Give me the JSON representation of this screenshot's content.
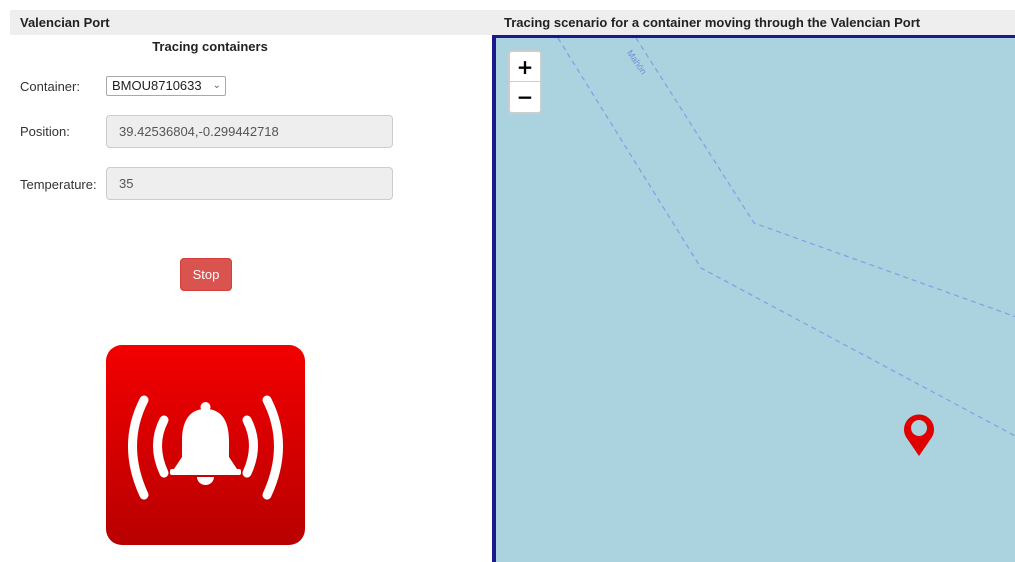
{
  "header": {
    "left_title": "Valencian Port",
    "right_title": "Tracing scenario for a container moving through the Valencian Port"
  },
  "panel": {
    "title": "Tracing containers",
    "container_label": "Container:",
    "container_value": "BMOU8710633",
    "position_label": "Position:",
    "position_value": "39.42536804,-0.299442718",
    "temperature_label": "Temperature:",
    "temperature_value": "35",
    "stop_label": "Stop"
  },
  "alarm": {
    "icon": "alarm-bell-icon",
    "color": "#e00000"
  },
  "map": {
    "zoom_in": "+",
    "zoom_out": "−",
    "route_label": "Mahón",
    "marker_icon": "map-marker-icon",
    "marker_color": "#e00000",
    "water_color": "#aad3df",
    "route_color": "#7f9fe6"
  }
}
